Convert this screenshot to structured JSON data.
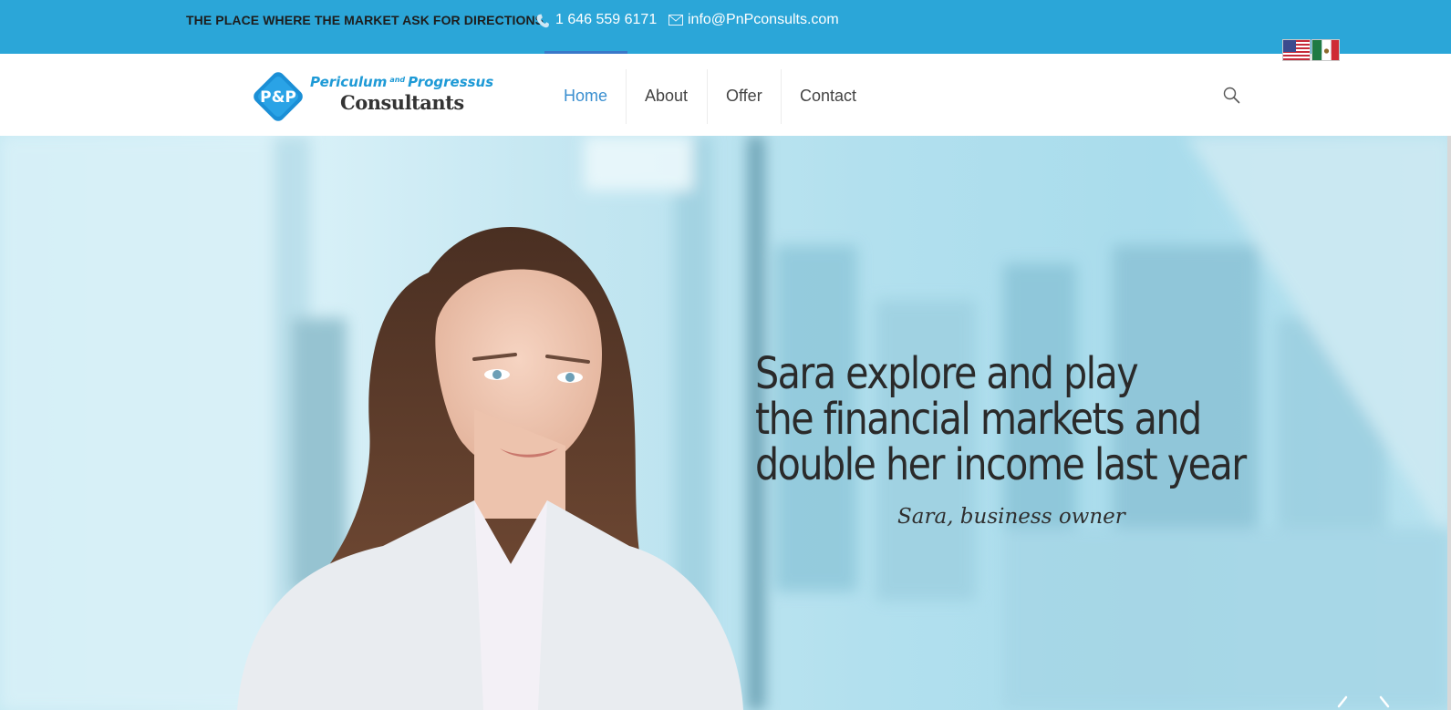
{
  "topbar": {
    "tagline": "THE PLACE WHERE THE MARKET ASK FOR DIRECTIONS",
    "phone": "1 646 559 6171",
    "email": "info@PnPconsults.com",
    "background_color": "#2ba6d8",
    "phone_icon": "phone-icon",
    "mail_icon": "mail-icon"
  },
  "languages": [
    {
      "name": "English",
      "icon": "us-flag-icon"
    },
    {
      "name": "Español",
      "icon": "mexico-flag-icon"
    }
  ],
  "logo": {
    "badge_text": "P&P",
    "line1_left": "Periculum",
    "line1_and": "and",
    "line1_right": "Progressus",
    "line2": "Consultants"
  },
  "nav": {
    "items": [
      {
        "label": "Home",
        "active": true
      },
      {
        "label": "About",
        "active": false
      },
      {
        "label": "Offer",
        "active": false
      },
      {
        "label": "Contact",
        "active": false
      }
    ],
    "active_color": "#3a8fd0",
    "search_icon": "search-icon"
  },
  "hero": {
    "headline": [
      "Sara explore and play",
      "the financial markets and",
      "double her income last year"
    ],
    "byline": "Sara, business owner",
    "prev_icon": "chevron-left-icon",
    "next_icon": "chevron-right-icon"
  }
}
